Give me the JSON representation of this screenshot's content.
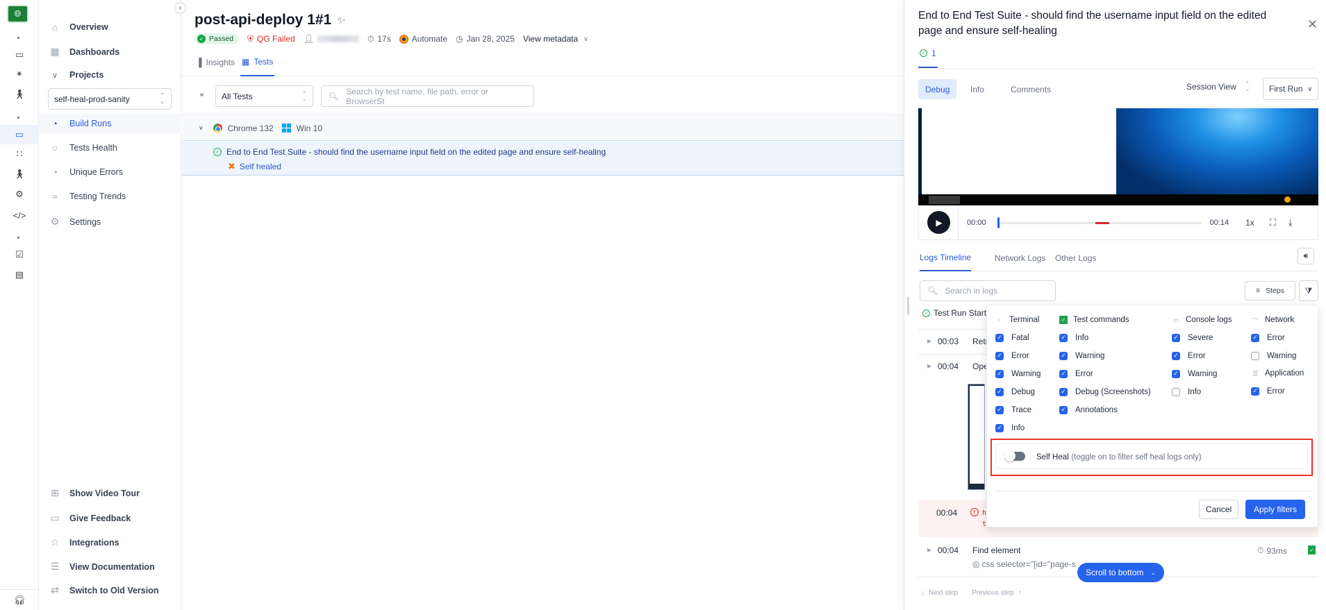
{
  "rail": {
    "logo_icon": "globe-icon",
    "items": [
      {
        "icon": "devices-icon"
      },
      {
        "icon": "visual-test-icon"
      },
      {
        "icon": "accessibility-icon"
      },
      {
        "icon": "test-reporting-icon",
        "active": true
      },
      {
        "icon": "grid-icon"
      },
      {
        "icon": "accessibility-settings-icon"
      },
      {
        "icon": "observability-icon"
      },
      {
        "icon": "code-settings-icon"
      },
      {
        "icon": "test-management-icon"
      },
      {
        "icon": "dashboard-settings-icon"
      }
    ],
    "bottom_icon": "headset-icon"
  },
  "nav": {
    "overview": "Overview",
    "dashboards": "Dashboards",
    "projects": "Projects",
    "project_selected": "self-heal-prod-sanity",
    "build_runs": "Build Runs",
    "tests_health": "Tests Health",
    "unique_errors": "Unique Errors",
    "testing_trends": "Testing Trends",
    "settings": "Settings",
    "show_video_tour": "Show Video Tour",
    "give_feedback": "Give Feedback",
    "integrations": "Integrations",
    "view_documentation": "View Documentation",
    "switch_old": "Switch to Old Version"
  },
  "build": {
    "title": "post-api-deploy 1#1",
    "status": "Passed",
    "quality_gate": "QG Failed",
    "duration": "17s",
    "product": "Automate",
    "date": "Jan 28, 2025",
    "view_metadata": "View metadata"
  },
  "tabs": {
    "insights": "Insights",
    "tests": "Tests"
  },
  "filters": {
    "test_filter": "All Tests",
    "search_placeholder": "Search by test name, file path, error or BrowserSt"
  },
  "group": {
    "browser": "Chrome 132",
    "os": "Win 10"
  },
  "test": {
    "name": "End to End Test Suite - should find the username input field on the edited page and ensure self-healing",
    "tag": "Self healed"
  },
  "panel": {
    "title": "End to End Test Suite - should find the username input field on the edited page and ensure self-healing",
    "attempt": "1",
    "tabs": {
      "debug": "Debug",
      "info": "Info",
      "comments": "Comments"
    },
    "session_view": "Session View",
    "run_select": "First Run",
    "video": {
      "current": "00:00",
      "total": "00:14",
      "speed": "1x",
      "progress": 0.0,
      "error_marker_start": 0.48,
      "error_marker_end": 0.55
    },
    "log_tabs": {
      "timeline": "Logs Timeline",
      "network": "Network Logs",
      "other": "Other Logs"
    },
    "log_search_placeholder": "Search in logs",
    "steps_label": "Steps",
    "run_start": "Test Run Start",
    "logs": [
      {
        "time": "00:03",
        "msg": "Retri"
      },
      {
        "time": "00:04",
        "msg": "Oper"
      }
    ],
    "error_log": {
      "time": "00:04",
      "line1": "h",
      "line2": "ti"
    },
    "find_log": {
      "time": "00:04",
      "msg": "Find element",
      "selector": "css selector=\"[id=\"page-s",
      "duration": "93ms"
    },
    "scroll_bottom": "Scroll to bottom",
    "next_step": "Next step",
    "previous_step": "Previous step"
  },
  "filter_popover": {
    "columns": [
      {
        "title": "Terminal",
        "icon": "terminal-icon",
        "groups": [
          {
            "options": [
              {
                "label": "Fatal",
                "checked": true
              },
              {
                "label": "Error",
                "checked": true
              },
              {
                "label": "Warning",
                "checked": true
              },
              {
                "label": "Debug",
                "checked": true
              },
              {
                "label": "Trace",
                "checked": true
              },
              {
                "label": "Info",
                "checked": true
              }
            ]
          }
        ]
      },
      {
        "title": "Test commands",
        "icon": "selenium-icon",
        "groups": [
          {
            "options": [
              {
                "label": "Info",
                "checked": true
              },
              {
                "label": "Warning",
                "checked": true
              },
              {
                "label": "Error",
                "checked": true
              },
              {
                "label": "Debug (Screenshots)",
                "checked": true
              },
              {
                "label": "Annotations",
                "checked": true
              }
            ]
          }
        ]
      },
      {
        "title": "Console logs",
        "icon": "monitor-icon",
        "groups": [
          {
            "options": [
              {
                "label": "Severe",
                "checked": true
              },
              {
                "label": "Error",
                "checked": true
              },
              {
                "label": "Warning",
                "checked": true
              },
              {
                "label": "Info",
                "checked": false
              }
            ]
          }
        ]
      },
      {
        "title": "Network",
        "icon": "wifi-icon",
        "groups": [
          {
            "options": [
              {
                "label": "Error",
                "checked": true
              },
              {
                "label": "Warning",
                "checked": false
              }
            ]
          }
        ]
      },
      {
        "title": "Application",
        "icon": "server-icon",
        "groups": [
          {
            "options": [
              {
                "label": "Error",
                "checked": true
              }
            ]
          }
        ]
      }
    ],
    "self_heal_label": "Self Heal",
    "self_heal_hint": "(toggle on to filter self heal logs only)",
    "self_heal_on": false,
    "cancel": "Cancel",
    "apply": "Apply filters"
  },
  "colors": {
    "accent": "#2563eb",
    "success": "#16a34a",
    "danger": "#dc2626",
    "highlight": "#ea3323"
  }
}
